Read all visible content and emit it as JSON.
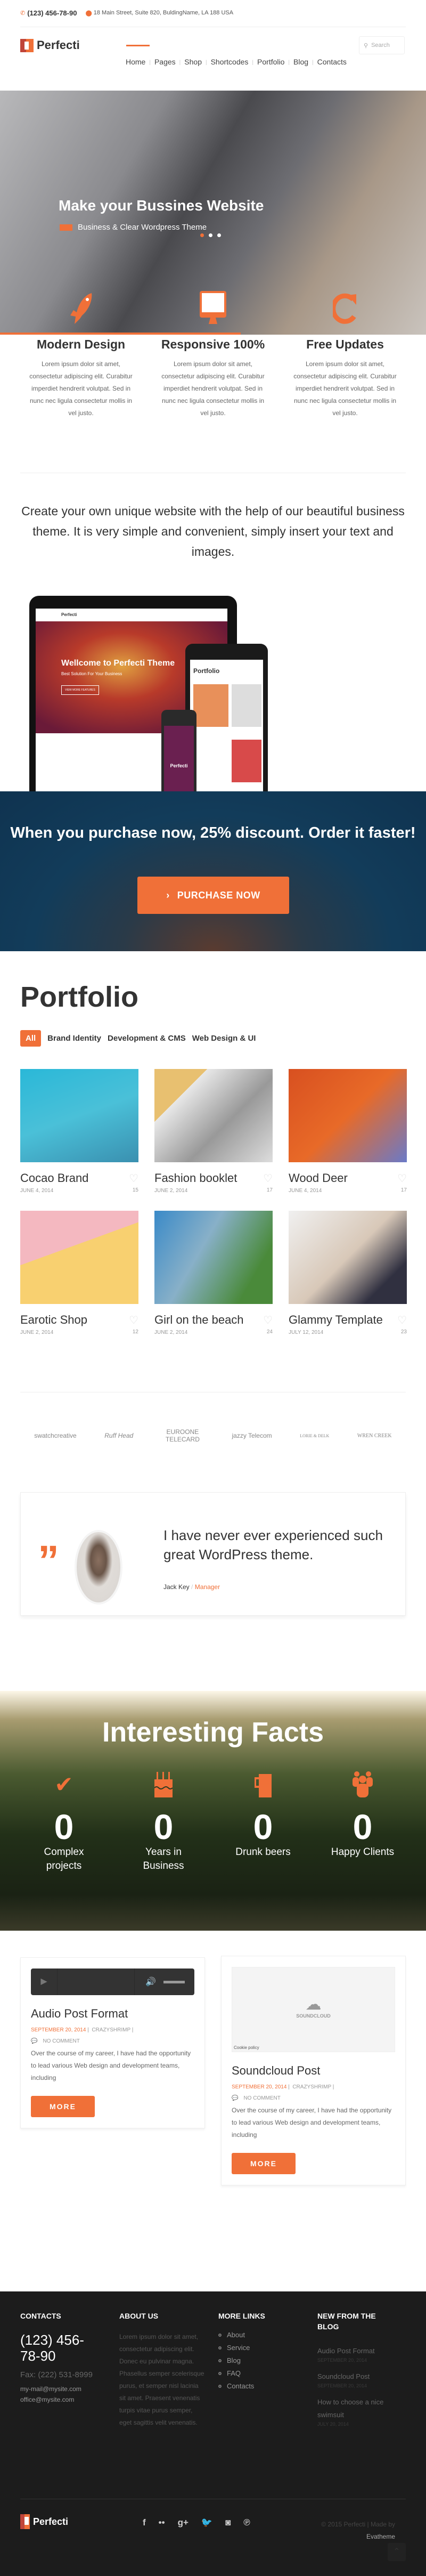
{
  "topbar": {
    "phone": "(123) 456-78-90",
    "address": "18 Main Street, Suite 820, BuldingName, LA 188 USA"
  },
  "brand": {
    "name": "Perfecti",
    "accent": "#f07038"
  },
  "nav": {
    "items": [
      "Home",
      "Pages",
      "Shop",
      "Shortcodes",
      "Portfolio",
      "Blog",
      "Contacts"
    ],
    "active": "Home",
    "search_placeholder": "Search"
  },
  "hero": {
    "title": "Make your Bussines Website",
    "subtitle": "Business & Clear Wordpress Theme",
    "slides": 3,
    "active_slide": 1
  },
  "features": [
    {
      "icon": "rocket-icon",
      "title": "Modern Design",
      "text": "Lorem ipsum dolor sit amet, consectetur adipiscing elit. Curabitur imperdiet hendrerit volutpat. Sed in nunc nec ligula consectetur mollis in vel justo."
    },
    {
      "icon": "monitor-icon",
      "title": "Responsive 100%",
      "text": "Lorem ipsum dolor sit amet, consectetur adipiscing elit. Curabitur imperdiet hendrerit volutpat. Sed in nunc nec ligula consectetur mollis in vel justo."
    },
    {
      "icon": "refresh-icon",
      "title": "Free Updates",
      "text": "Lorem ipsum dolor sit amet, consectetur adipiscing elit. Curabitur imperdiet hendrerit volutpat. Sed in nunc nec ligula consectetur mollis in vel justo."
    }
  ],
  "intro": "Create your own unique website with the help of our beautiful business theme. It is very simple and convenient, simply insert your text and images.",
  "mockup": {
    "laptop_title": "Wellcome to Perfecti Theme",
    "laptop_sub": "Best Solution For Your Business",
    "laptop_button": "VIEW MORE FEATURES",
    "tablet_title": "Portfolio",
    "phone_brand": "Perfecti"
  },
  "promo": {
    "title": "When you purchase now, 25% discount. Order it faster!",
    "button": "PURCHASE NOW"
  },
  "portfolio": {
    "title": "Portfolio",
    "filters": [
      "All",
      "Brand Identity",
      "Development & CMS",
      "Web Design & UI"
    ],
    "active_filter": "All",
    "items": [
      {
        "title": "Cocao Brand",
        "date": "JUNE 4, 2014",
        "likes": "15"
      },
      {
        "title": "Fashion booklet",
        "date": "JUNE 2, 2014",
        "likes": "17"
      },
      {
        "title": "Wood Deer",
        "date": "JUNE 4, 2014",
        "likes": "17"
      },
      {
        "title": "Earotic Shop",
        "date": "JUNE 2, 2014",
        "likes": "12"
      },
      {
        "title": "Girl on the beach",
        "date": "JUNE 2, 2014",
        "likes": "24"
      },
      {
        "title": "Glammy Template",
        "date": "JULY 12, 2014",
        "likes": "23"
      }
    ]
  },
  "clients": [
    "swatchcreative",
    "Ruff Head",
    "EUROONE TELECARD",
    "jazzy Telecom",
    "LORIE & DELK",
    "WREN CREEK"
  ],
  "testimonial": {
    "quote": "I have never ever experienced such great WordPress theme.",
    "author": "Jack Key",
    "role": "Manager",
    "separator": "/"
  },
  "facts": {
    "title": "Interesting Facts",
    "items": [
      {
        "icon": "check-icon",
        "value": "0",
        "label": "Complex projects"
      },
      {
        "icon": "cake-icon",
        "value": "0",
        "label": "Years in Business"
      },
      {
        "icon": "beer-mug-icon",
        "value": "0",
        "label": "Drunk beers"
      },
      {
        "icon": "users-icon",
        "value": "0",
        "label": "Happy Clients"
      }
    ]
  },
  "posts": [
    {
      "title": "Audio Post Format",
      "date": "SEPTEMBER 20, 2014",
      "author": "CRAZYSHRIMP",
      "comments": "NO COMMENT",
      "excerpt": "Over the course of my career, I have had the opportunity to lead various Web design and development teams, including",
      "button": "MORE"
    },
    {
      "title": "Soundcloud Post",
      "date": "SEPTEMBER 20, 2014",
      "author": "CRAZYSHRIMP",
      "comments": "NO COMMENT",
      "excerpt": "Over the course of my career, I have had the opportunity to lead various Web design and development teams, including",
      "button": "MORE",
      "embed_logo": "SOUNDCLOUD",
      "embed_note": "Cookie policy"
    }
  ],
  "footer": {
    "contacts": {
      "title": "CONTACTS",
      "phone": "(123) 456-78-90",
      "fax": "Fax: (222) 531-8999",
      "emails": [
        "my-mail@mysite.com",
        "office@mysite.com"
      ]
    },
    "about": {
      "title": "ABOUT US",
      "text": "Lorem ipsum dolor sit amet, consectetur adipiscing elit. Donec eu pulvinar magna. Phasellus semper scelerisque purus, et semper nisl lacinia sit amet. Praesent venenatis turpis vitae purus semper, eget sagittis velit venenatis."
    },
    "links": {
      "title": "MORE LINKS",
      "items": [
        "About",
        "Service",
        "Blog",
        "FAQ",
        "Contacts"
      ]
    },
    "blog": {
      "title": "NEW FROM THE BLOG",
      "items": [
        {
          "title": "Audio Post Format",
          "date": "SEPTEMBER 20, 2014"
        },
        {
          "title": "Soundcloud Post",
          "date": "SEPTEMBER 20, 2014"
        },
        {
          "title": "How to choose a nice swimsuit",
          "date": "JULY 20, 2014"
        }
      ]
    },
    "social": [
      "facebook-icon",
      "flickr-icon",
      "google-plus-icon",
      "twitter-icon",
      "instagram-icon",
      "pinterest-icon"
    ],
    "copyright": "© 2015 Perfecti | Made by",
    "credit": "Evatheme"
  }
}
